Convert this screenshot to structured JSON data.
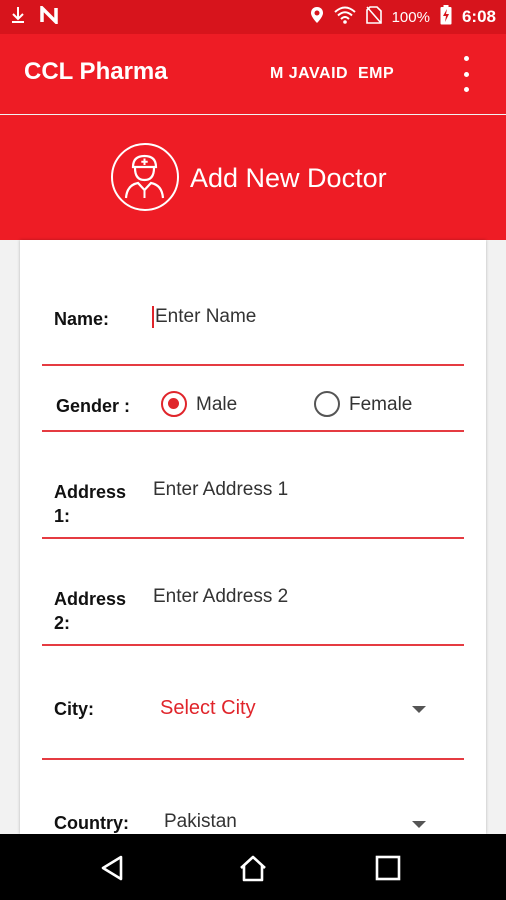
{
  "status_bar": {
    "battery_percent": "100%",
    "time": "6:08",
    "icons": [
      "download-icon",
      "n-icon",
      "location-icon",
      "wifi-icon",
      "no-sim-icon",
      "battery-charging-icon"
    ]
  },
  "app_bar": {
    "title": "CCL Pharma",
    "user": "M JAVAID  EMP",
    "menu_icon": "more-vert-icon"
  },
  "header": {
    "title": "Add New Doctor",
    "icon": "doctor-icon"
  },
  "form": {
    "name": {
      "label": "Name:",
      "placeholder": "Enter Name"
    },
    "gender": {
      "label": "Gender :",
      "options": [
        "Male",
        "Female"
      ],
      "selected": "Male"
    },
    "address1": {
      "label_line1": "Address",
      "label_line2": "1:",
      "placeholder": "Enter Address 1"
    },
    "address2": {
      "label_line1": "Address",
      "label_line2": "2:",
      "placeholder": "Enter Address 2"
    },
    "city": {
      "label": "City:",
      "value": "Select City"
    },
    "country": {
      "label": "Country:",
      "value": "Pakistan"
    }
  },
  "nav_bar": {
    "icons": [
      "back-icon",
      "home-icon",
      "recents-icon"
    ]
  },
  "colors": {
    "primary": "#ee1c25",
    "status_bar": "#d7141c",
    "accent": "#e0252b"
  }
}
